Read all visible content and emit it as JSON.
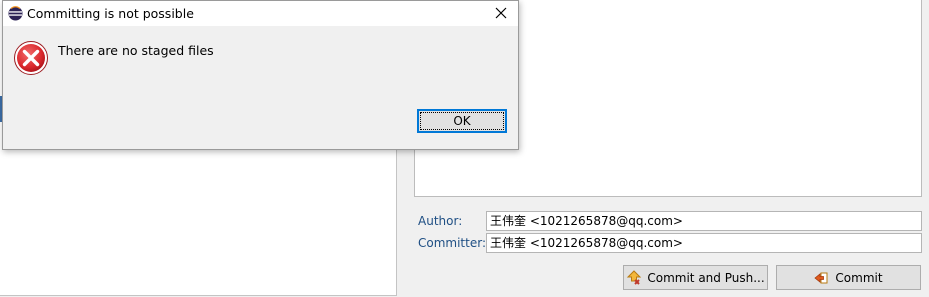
{
  "dialog": {
    "title": "Committing is not possible",
    "message": "There are no staged files",
    "ok_label": "OK",
    "icon": "error-icon",
    "app_icon": "eclipse-icon",
    "close_icon": "close-icon"
  },
  "commit_form": {
    "author_label": "Author:",
    "author_value": "王伟奎 <1021265878@qq.com>",
    "committer_label": "Committer:",
    "committer_value": "王伟奎 <1021265878@qq.com>",
    "commit_and_push_label": "Commit and Push...",
    "commit_label": "Commit",
    "commit_and_push_icon": "push-icon",
    "commit_icon": "commit-icon"
  },
  "colors": {
    "error_red": "#d9262b",
    "focus_blue": "#0078d7",
    "label_blue": "#1f4f84"
  }
}
